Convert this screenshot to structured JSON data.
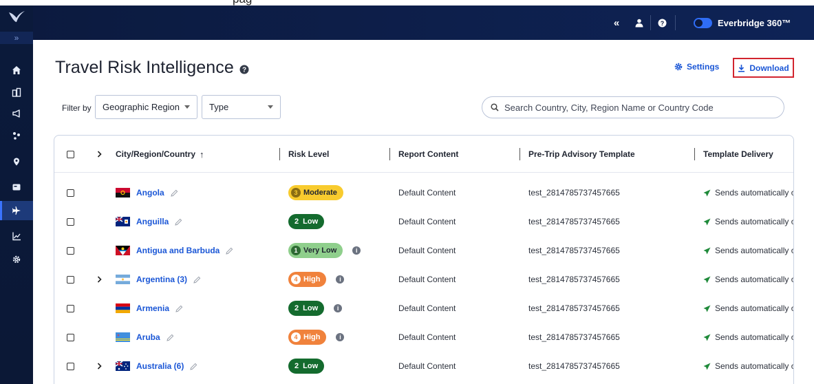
{
  "top_strip_text": "pag",
  "header": {
    "collapse_label": "«",
    "brand": "Everbridge 360™"
  },
  "sidebar": {
    "expand_label": "»",
    "items": [
      {
        "icon": "home-icon"
      },
      {
        "icon": "buildings-icon"
      },
      {
        "icon": "megaphone-icon"
      },
      {
        "icon": "people-network-icon"
      },
      {
        "icon": "location-pin-icon"
      },
      {
        "icon": "id-card-icon"
      },
      {
        "icon": "airplane-icon",
        "active": true
      },
      {
        "icon": "chart-line-icon"
      },
      {
        "icon": "gear-icon"
      }
    ]
  },
  "page": {
    "title": "Travel Risk Intelligence",
    "settings_label": "Settings",
    "download_label": "Download"
  },
  "filters": {
    "label": "Filter by",
    "region_label": "Geographic Region",
    "type_label": "Type",
    "search_placeholder": "Search Country, City, Region Name or Country Code"
  },
  "table": {
    "columns": {
      "city": "City/Region/Country",
      "sort_indicator": "↑",
      "risk": "Risk Level",
      "report": "Report Content",
      "template": "Pre-Trip Advisory Template",
      "delivery": "Template Delivery"
    },
    "rows": [
      {
        "name": "Angola",
        "flag": "angola",
        "expandable": false,
        "risk_label": "Moderate",
        "risk_num": "3",
        "risk_class": "moderate",
        "info": false,
        "report": "Default Content",
        "template": "test_2814785737457665",
        "delivery": "Sends automatically or"
      },
      {
        "name": "Anguilla",
        "flag": "anguilla",
        "expandable": false,
        "risk_label": "Low",
        "risk_num": "2",
        "risk_class": "low",
        "info": false,
        "report": "Default Content",
        "template": "test_2814785737457665",
        "delivery": "Sends automatically or"
      },
      {
        "name": "Antigua and Barbuda",
        "flag": "antigua",
        "expandable": false,
        "risk_label": "Very Low",
        "risk_num": "1",
        "risk_class": "verylow",
        "info": true,
        "report": "Default Content",
        "template": "test_2814785737457665",
        "delivery": "Sends automatically or"
      },
      {
        "name": "Argentina (3)",
        "flag": "argentina",
        "expandable": true,
        "risk_label": "High",
        "risk_num": "4",
        "risk_class": "high",
        "info": true,
        "report": "Default Content",
        "template": "test_2814785737457665",
        "delivery": "Sends automatically or"
      },
      {
        "name": "Armenia",
        "flag": "armenia",
        "expandable": false,
        "risk_label": "Low",
        "risk_num": "2",
        "risk_class": "low",
        "info": true,
        "report": "Default Content",
        "template": "test_2814785737457665",
        "delivery": "Sends automatically or"
      },
      {
        "name": "Aruba",
        "flag": "aruba",
        "expandable": false,
        "risk_label": "High",
        "risk_num": "4",
        "risk_class": "high",
        "info": true,
        "report": "Default Content",
        "template": "test_2814785737457665",
        "delivery": "Sends automatically or"
      },
      {
        "name": "Australia (6)",
        "flag": "australia",
        "expandable": true,
        "risk_label": "Low",
        "risk_num": "2",
        "risk_class": "low",
        "info": false,
        "report": "Default Content",
        "template": "test_2814785737457665",
        "delivery": "Sends automatically or"
      }
    ]
  },
  "colors": {
    "nav_bg": "#0c1a3e",
    "link_blue": "#1a56d6",
    "download_border": "#d2242e",
    "risk_moderate": "#f8cb2e",
    "risk_low": "#146b2e",
    "risk_verylow": "#8fcf8c",
    "risk_high": "#f0823c",
    "delivery_check": "#1f8a3a"
  }
}
